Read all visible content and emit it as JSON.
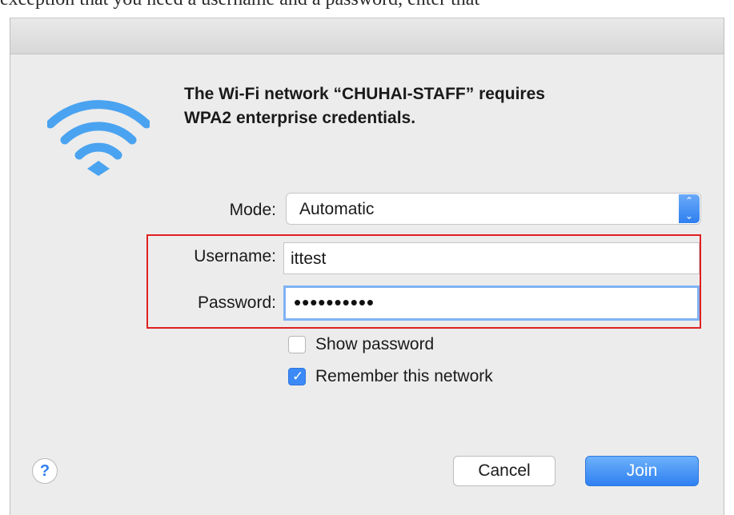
{
  "page_header_text": "exception that you need a username and a password, enter that",
  "dialog": {
    "headline_line1": "The Wi-Fi network “CHUHAI-STAFF” requires",
    "headline_line2": "WPA2 enterprise credentials."
  },
  "form": {
    "mode": {
      "label": "Mode:",
      "value": "Automatic"
    },
    "username": {
      "label": "Username:",
      "value": "ittest"
    },
    "password": {
      "label": "Password:",
      "masked_value": "••••••••••"
    }
  },
  "options": {
    "show_password": {
      "label": "Show password",
      "checked": false
    },
    "remember_network": {
      "label": "Remember this network",
      "checked": true
    }
  },
  "buttons": {
    "help": "?",
    "cancel": "Cancel",
    "join": "Join"
  },
  "icons": {
    "wifi": "wifi-icon",
    "stepper": "up-down-chevron-icon",
    "check": "checkmark-icon"
  },
  "colors": {
    "accent": "#3b8af6",
    "highlight_box": "#e02020",
    "wifi": "#4aa3f0"
  }
}
